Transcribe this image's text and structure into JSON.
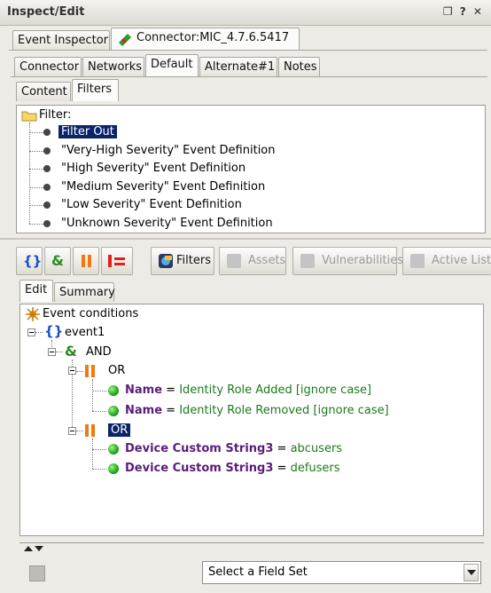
{
  "window": {
    "title": "Inspect/Edit",
    "controls": "❐ ? ✕"
  },
  "top_tabs": [
    "Event Inspector",
    "Connector:MIC_4.7.6.5417"
  ],
  "sub_tabs": [
    "Connector",
    "Networks",
    "Default",
    "Alternate#1",
    "Notes"
  ],
  "default_tabs": [
    "Content",
    "Filters"
  ],
  "filter_tree": {
    "root": "Filter:",
    "items": [
      "Filter Out",
      "\"Very-High Severity\" Event Definition",
      "\"High Severity\" Event Definition",
      "\"Medium Severity\" Event Definition",
      "\"Low Severity\" Event Definition",
      "\"Unknown Severity\" Event Definition"
    ],
    "selected_index": 0
  },
  "toolbar": {
    "filters": "Filters",
    "assets": "Assets",
    "vulnerabilities": "Vulnerabilities",
    "active_list": "Active List"
  },
  "edit_tabs": [
    "Edit",
    "Summary"
  ],
  "conditions": {
    "root": "Event conditions",
    "event": "event1",
    "and": "AND",
    "or1": "OR",
    "or2": "OR",
    "c1": {
      "field": "Name",
      "op": "=",
      "value": "Identity Role Added [ignore case]"
    },
    "c2": {
      "field": "Name",
      "op": "=",
      "value": "Identity Role Removed [ignore case]"
    },
    "c3": {
      "field": "Device Custom String3",
      "op": "=",
      "value": "abcusers"
    },
    "c4": {
      "field": "Device Custom String3",
      "op": "=",
      "value": "defusers"
    }
  },
  "field_set": {
    "value": "Select a Field Set"
  },
  "colors": {
    "selection": "#0a246a",
    "field_name": "#5b1c7a",
    "field_value": "#1c7a1c",
    "or_icon": "#f07a12"
  }
}
